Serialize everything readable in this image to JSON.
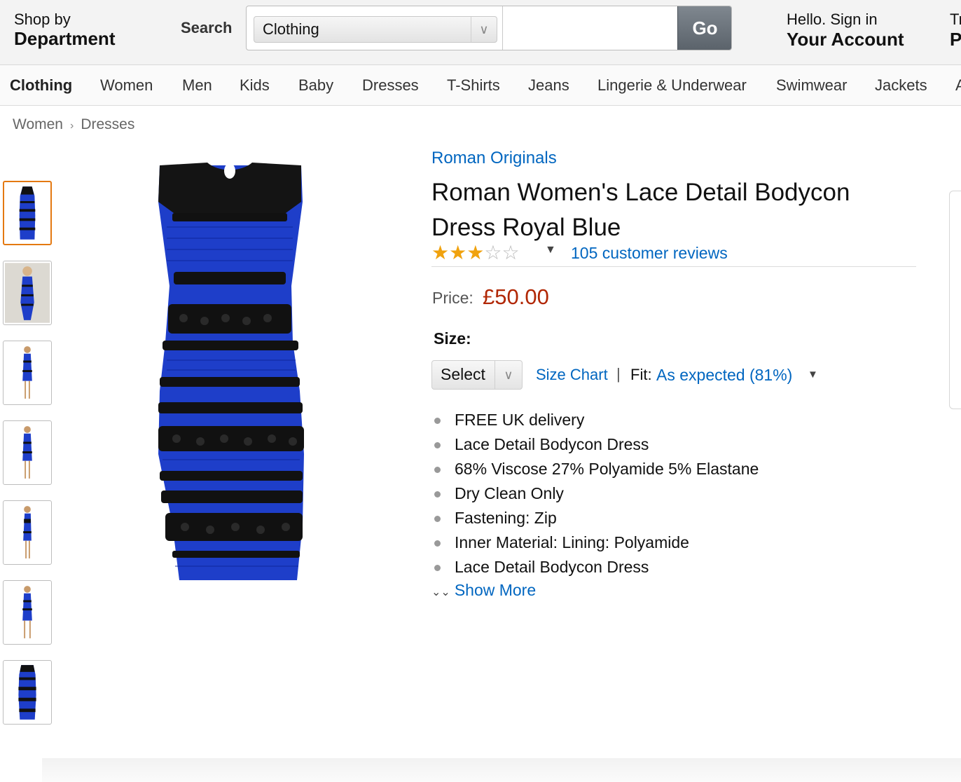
{
  "header": {
    "shop_by_line1": "Shop by",
    "shop_by_line2": "Department",
    "search_label": "Search",
    "search_category": "Clothing",
    "search_placeholder": "",
    "go_label": "Go",
    "account_line1": "Hello. Sign in",
    "account_line2": "Your Account",
    "truncated_line1": "Tr",
    "truncated_line2": "P"
  },
  "nav": {
    "items": [
      "Clothing",
      "Women",
      "Men",
      "Kids",
      "Baby",
      "Dresses",
      "T-Shirts",
      "Jeans",
      "Lingerie & Underwear",
      "Swimwear",
      "Jackets",
      "A"
    ]
  },
  "breadcrumb": {
    "items": [
      "Women",
      "Dresses"
    ],
    "separator": "›"
  },
  "thumbnails": {
    "count": 7,
    "selected_index": 0
  },
  "product": {
    "brand": "Roman Originals",
    "title": "Roman Women's Lace Detail Bodycon Dress Royal Blue",
    "rating": {
      "stars": 3,
      "max": 5
    },
    "reviews": "105 customer reviews",
    "price_label": "Price:",
    "price": "£50.00",
    "size_label": "Size:",
    "size_select": "Select",
    "size_chart": "Size Chart",
    "fit_label": "Fit:",
    "fit_value": "As expected (81%)",
    "bullets": [
      "FREE UK delivery",
      "Lace Detail Bodycon Dress",
      "68% Viscose 27% Polyamide 5% Elastane",
      "Dry Clean Only",
      "Fastening: Zip",
      "Inner Material: Lining: Polyamide",
      "Lace Detail Bodycon Dress"
    ],
    "show_more": "Show More"
  },
  "colors": {
    "link": "#0066c0",
    "price": "#b12704",
    "dress_blue": "#1e3ec9",
    "dress_black": "#111111",
    "star": "#f0a20e",
    "selected_thumb_border": "#e47911"
  }
}
